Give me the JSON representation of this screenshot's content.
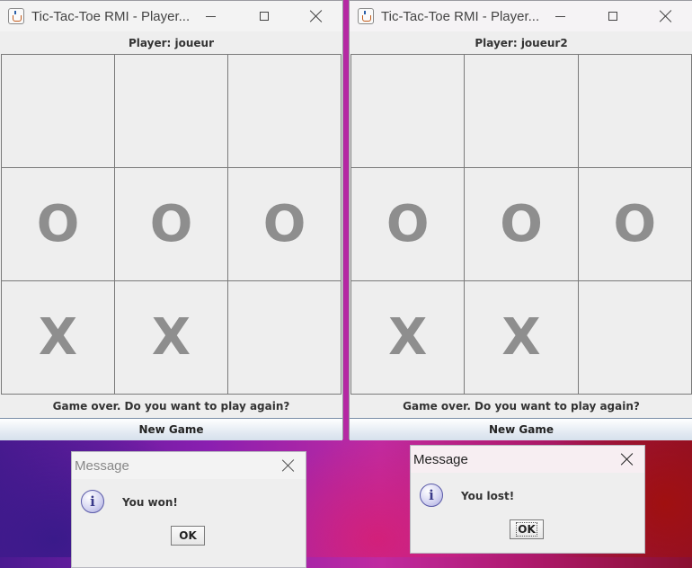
{
  "windows": [
    {
      "title": "Tic-Tac-Toe RMI - Player...",
      "player_label": "Player: joueur",
      "board": [
        "",
        "",
        "",
        "O",
        "O",
        "O",
        "X",
        "X",
        ""
      ],
      "status": "Game over. Do you want to play again?",
      "new_game_label": "New Game"
    },
    {
      "title": "Tic-Tac-Toe RMI - Player...",
      "player_label": "Player: joueur2",
      "board": [
        "",
        "",
        "",
        "O",
        "O",
        "O",
        "X",
        "X",
        ""
      ],
      "status": "Game over. Do you want to play again?",
      "new_game_label": "New Game"
    }
  ],
  "dialogs": [
    {
      "title": "Message",
      "message": "You won!",
      "ok_label": "OK",
      "icon": "info-icon"
    },
    {
      "title": "Message",
      "message": "You lost!",
      "ok_label": "OK",
      "icon": "info-icon"
    }
  ]
}
